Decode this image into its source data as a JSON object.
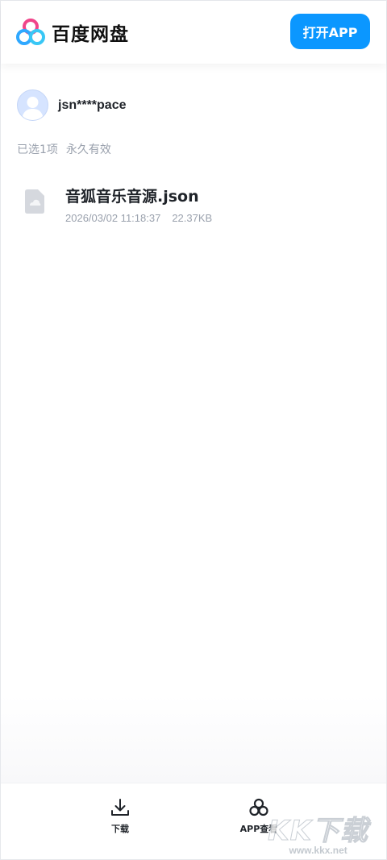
{
  "header": {
    "logo_text": "百度网盘",
    "open_app_label": "打开APP",
    "accent": "#0b97ff"
  },
  "user": {
    "name": "jsn****pace"
  },
  "share": {
    "selected": "已选1项",
    "validity": "永久有效"
  },
  "file": {
    "name": "音狐音乐音源.json",
    "datetime": "2026/03/02 11:18:37",
    "size": "22.37KB",
    "icon": "file-icon"
  },
  "bottom_bar": {
    "download_label": "下载",
    "app_view_label": "APP查看"
  },
  "watermark": {
    "main": "KK下载",
    "site": "www.kkx.net"
  }
}
